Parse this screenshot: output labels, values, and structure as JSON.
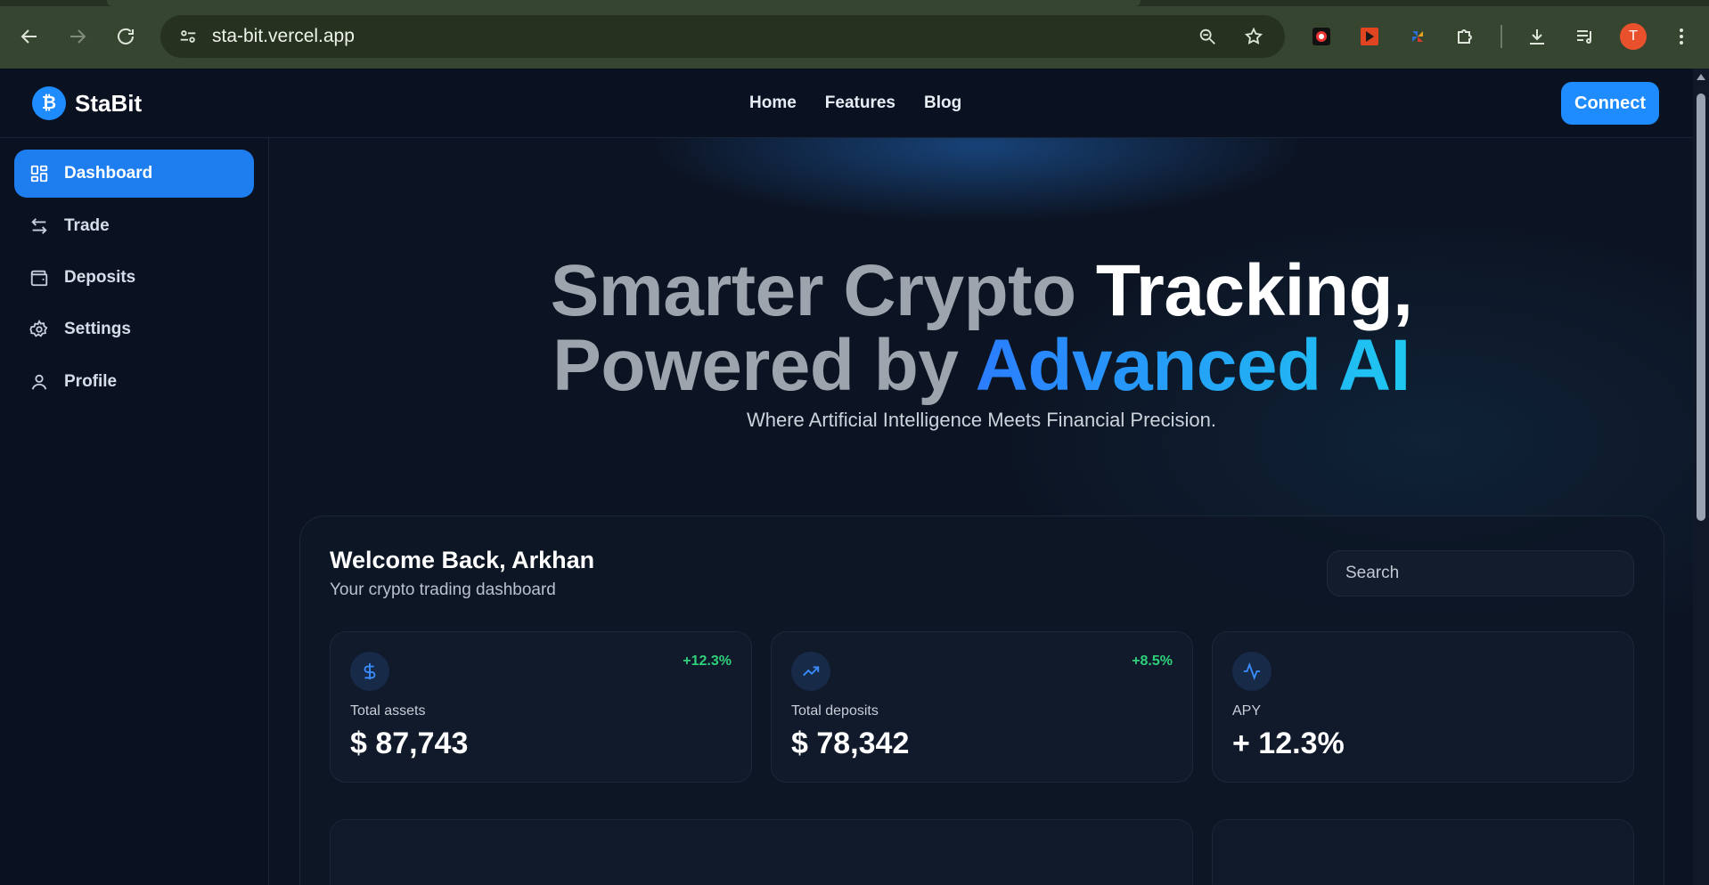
{
  "browser": {
    "url": "sta-bit.vercel.app",
    "avatar_letter": "T"
  },
  "app": {
    "brand": {
      "logo_symbol": "₿",
      "name": "StaBit"
    },
    "topnav": [
      {
        "label": "Home"
      },
      {
        "label": "Features"
      },
      {
        "label": "Blog"
      }
    ],
    "connect_label": "Connect",
    "sidebar": [
      {
        "label": "Dashboard",
        "icon": "grid-icon",
        "active": true
      },
      {
        "label": "Trade",
        "icon": "swap-arrows-icon",
        "active": false
      },
      {
        "label": "Deposits",
        "icon": "wallet-icon",
        "active": false
      },
      {
        "label": "Settings",
        "icon": "gear-icon",
        "active": false
      },
      {
        "label": "Profile",
        "icon": "user-icon",
        "active": false
      }
    ],
    "hero": {
      "line1_muted": "Smarter Crypto ",
      "line1_bright": "Tracking,",
      "line2_muted": "Powered by ",
      "line2_accent": "Advanced AI",
      "subtitle": "Where Artificial Intelligence Meets Financial Precision."
    },
    "dashboard": {
      "welcome": "Welcome Back, Arkhan",
      "subtitle": "Your crypto trading dashboard",
      "search_placeholder": "Search",
      "cards": [
        {
          "icon": "dollar-icon",
          "label": "Total assets",
          "value": "$ 87,743",
          "change": "+12.3%"
        },
        {
          "icon": "trending-up-icon",
          "label": "Total deposits",
          "value": "$ 78,342",
          "change": "+8.5%"
        },
        {
          "icon": "activity-icon",
          "label": "APY",
          "value": "+ 12.3%",
          "change": ""
        }
      ]
    }
  },
  "colors": {
    "accent": "#1e8bff",
    "positive": "#2fd07a",
    "background": "#0b1322"
  }
}
